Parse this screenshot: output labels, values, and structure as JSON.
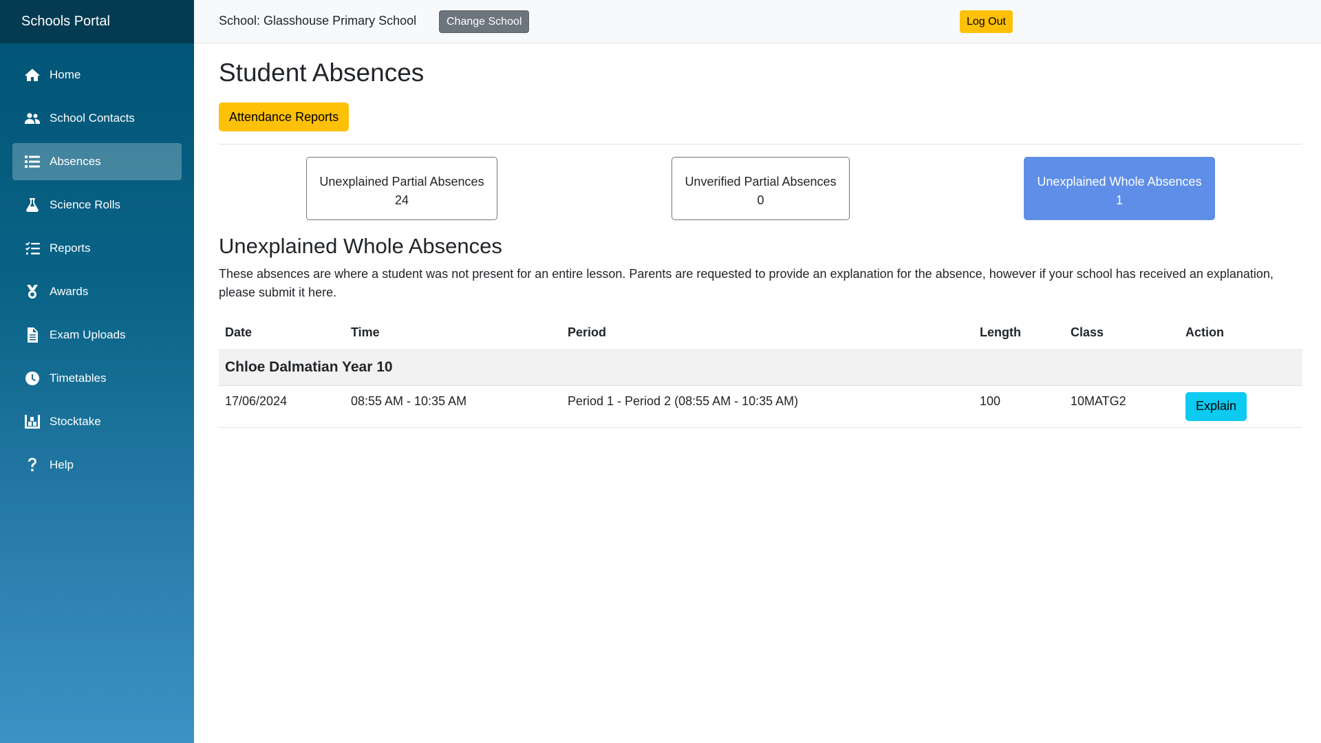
{
  "brand": "Schools Portal",
  "sidebar": {
    "items": [
      {
        "label": "Home",
        "icon": "home-icon"
      },
      {
        "label": "School Contacts",
        "icon": "users-icon"
      },
      {
        "label": "Absences",
        "icon": "list-icon",
        "active": true
      },
      {
        "label": "Science Rolls",
        "icon": "flask-icon"
      },
      {
        "label": "Reports",
        "icon": "checklist-icon"
      },
      {
        "label": "Awards",
        "icon": "medal-icon"
      },
      {
        "label": "Exam Uploads",
        "icon": "file-icon"
      },
      {
        "label": "Timetables",
        "icon": "clock-icon"
      },
      {
        "label": "Stocktake",
        "icon": "warehouse-icon"
      },
      {
        "label": "Help",
        "icon": "question-icon"
      }
    ]
  },
  "topbar": {
    "school_label": "School: Glasshouse Primary School",
    "change_school_label": "Change School",
    "logout_label": "Log Out"
  },
  "main": {
    "title": "Student Absences",
    "attendance_reports_label": "Attendance Reports",
    "cards": [
      {
        "label": "Unexplained Partial Absences",
        "count": "24"
      },
      {
        "label": "Unverified Partial Absences",
        "count": "0"
      },
      {
        "label": "Unexplained Whole Absences",
        "count": "1",
        "selected": true
      }
    ],
    "section_title": "Unexplained Whole Absences",
    "section_desc": "These absences are where a student was not present for an entire lesson. Parents are requested to provide an explanation for the absence, however if your school has received an explanation, please submit it here.",
    "table": {
      "headers": [
        "Date",
        "Time",
        "Period",
        "Length",
        "Class",
        "Action"
      ],
      "group": "Chloe Dalmatian Year 10",
      "rows": [
        {
          "date": "17/06/2024",
          "time": "08:55 AM - 10:35 AM",
          "period": "Period 1 - Period 2 (08:55 AM - 10:35 AM)",
          "length": "100",
          "class": "10MATG2",
          "action": "Explain"
        }
      ]
    }
  },
  "colors": {
    "sidebar_top": "#005273",
    "sidebar_bottom": "#3b92c4",
    "accent_yellow": "#ffc107",
    "selected_card": "#5e8ee8",
    "explain_button": "#0dcaf0"
  }
}
